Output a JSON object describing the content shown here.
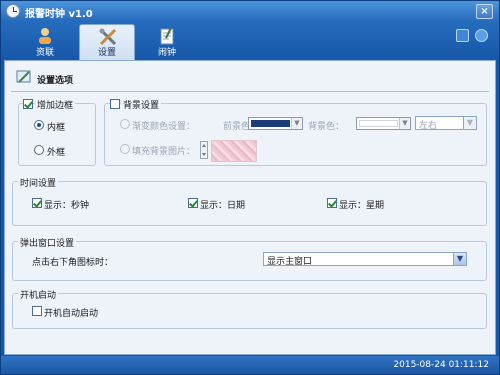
{
  "window": {
    "title": "报警时钟 v1.0",
    "close_label": "×"
  },
  "tabs": [
    {
      "label": "资联"
    },
    {
      "label": "设置"
    },
    {
      "label": "闹钟"
    }
  ],
  "section": {
    "title": "设置选项"
  },
  "border_group": {
    "checkbox_label": "增加边框",
    "checked": true,
    "inner_label": "内框",
    "outer_label": "外框"
  },
  "background_group": {
    "checkbox_label": "背景设置",
    "gradient_label": "渐变颜色设置：",
    "foreground_label": "前景色：",
    "background_label": "背景色：",
    "direction_value": "左右",
    "fill_label": "填充背景图片："
  },
  "time_group": {
    "title": "时间设置",
    "show_seconds": "显示：秒钟",
    "show_date": "显示：日期",
    "show_weekday": "显示：星期"
  },
  "popup_group": {
    "title": "弹出窗口设置",
    "tray_label": "点击右下角图标时：",
    "tray_value": "显示主窗口"
  },
  "startup_group": {
    "title": "开机启动",
    "autostart_label": "开机自动启动"
  },
  "status": {
    "datetime": "2015-08-24  01:11:12"
  },
  "colors": {
    "foreground_swatch": "#1a3d7a",
    "background_swatch": "#ffffff"
  }
}
